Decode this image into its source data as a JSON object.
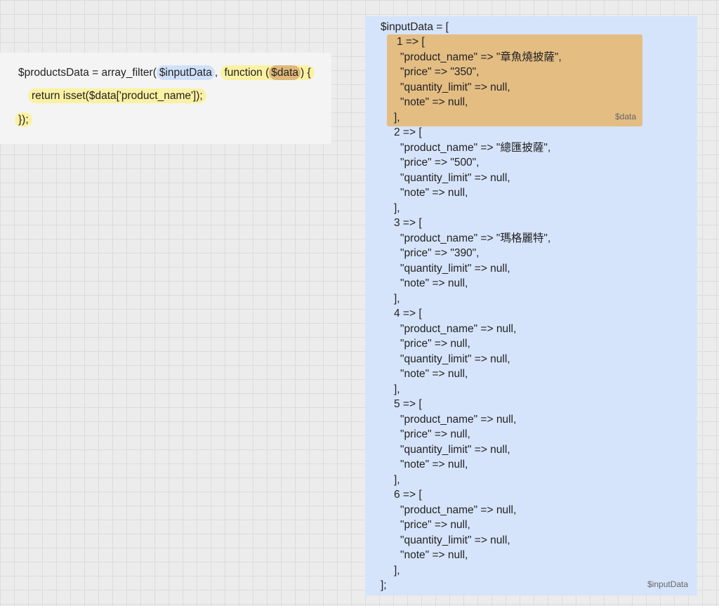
{
  "code": {
    "line1": {
      "prefix": "$productsData = array_filter(",
      "input_var": "$inputData",
      "comma": ", ",
      "func_kw": "function (",
      "data_var": "$data",
      "func_end": ") {"
    },
    "line2": "return isset($data['product_name']);",
    "line3": "});"
  },
  "input_data": {
    "header": "$inputData = [",
    "footer": "];",
    "caption": "$inputData",
    "item_caption": "$data",
    "items": [
      {
        "open": "1 => [",
        "product_name": "\"product_name\" => \"章魚燒披薩\",",
        "price": "\"price\" => \"350\",",
        "quantity_limit": "\"quantity_limit\" => null,",
        "note": "\"note\" => null,",
        "close": "],"
      },
      {
        "open": "2 => [",
        "product_name": "\"product_name\" => \"總匯披薩\",",
        "price": "\"price\" => \"500\",",
        "quantity_limit": "\"quantity_limit\" => null,",
        "note": "\"note\" => null,",
        "close": "],"
      },
      {
        "open": "3 => [",
        "product_name": "\"product_name\" => \"瑪格麗特\",",
        "price": "\"price\" => \"390\",",
        "quantity_limit": "\"quantity_limit\" => null,",
        "note": "\"note\" => null,",
        "close": "],"
      },
      {
        "open": "4 => [",
        "product_name": "\"product_name\" => null,",
        "price": "\"price\" => null,",
        "quantity_limit": "\"quantity_limit\" => null,",
        "note": "\"note\" => null,",
        "close": "],"
      },
      {
        "open": "5 => [",
        "product_name": "\"product_name\" => null,",
        "price": "\"price\" => null,",
        "quantity_limit": "\"quantity_limit\" => null,",
        "note": "\"note\" => null,",
        "close": "],"
      },
      {
        "open": "6 => [",
        "product_name": "\"product_name\" => null,",
        "price": "\"price\" => null,",
        "quantity_limit": "\"quantity_limit\" => null,",
        "note": "\"note\" => null,",
        "close": "],"
      }
    ]
  },
  "colors": {
    "canvas": "#ececec",
    "code_panel": "#f4f4f4",
    "highlight_yellow": "#fbf1a3",
    "highlight_blue": "#cfe1fa",
    "highlight_orange": "#e0b87a",
    "data_panel": "#d6e4fb",
    "item_box": "#e4bd83"
  }
}
